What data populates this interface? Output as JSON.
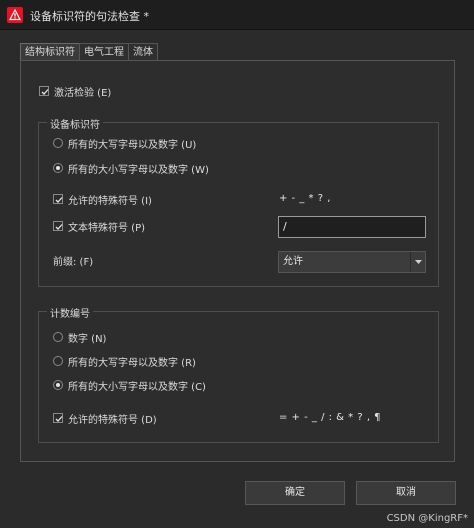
{
  "window": {
    "title": "设备标识符的句法检查 *"
  },
  "tabs": [
    {
      "label": "结构标识符",
      "active": true
    },
    {
      "label": "电气工程",
      "active": false
    },
    {
      "label": "流体",
      "active": false
    }
  ],
  "activate_check": {
    "label": "激活检验 (E)",
    "checked": true
  },
  "device_group": {
    "label": "设备标识符",
    "radio_upper": {
      "label": "所有的大写字母以及数字 (U)",
      "selected": false
    },
    "radio_mixed": {
      "label": "所有的大小写字母以及数字 (W)",
      "selected": true
    },
    "allow_special": {
      "label": "允许的特殊符号 (I)",
      "checked": true,
      "value": "+ - _ * ? ,"
    },
    "text_special": {
      "label": "文本特殊符号 (P)",
      "checked": true,
      "value": "/"
    },
    "prefix": {
      "label": "前缀: (F)",
      "value": "允许"
    }
  },
  "count_group": {
    "label": "计数编号",
    "radio_digits": {
      "label": "数字 (N)",
      "selected": false
    },
    "radio_upper": {
      "label": "所有的大写字母以及数字 (R)",
      "selected": false
    },
    "radio_mixed": {
      "label": "所有的大小写字母以及数字 (C)",
      "selected": true
    },
    "allow_special": {
      "label": "允许的特殊符号 (D)",
      "checked": true,
      "value": "= + - _ / : & * ? , ¶"
    }
  },
  "buttons": {
    "ok": "确定",
    "cancel": "取消"
  },
  "watermark": "CSDN @KingRF*",
  "colors": {
    "background": "#2b2b2b",
    "titlebar": "#1e1e1e",
    "app_icon": "#e81123"
  }
}
